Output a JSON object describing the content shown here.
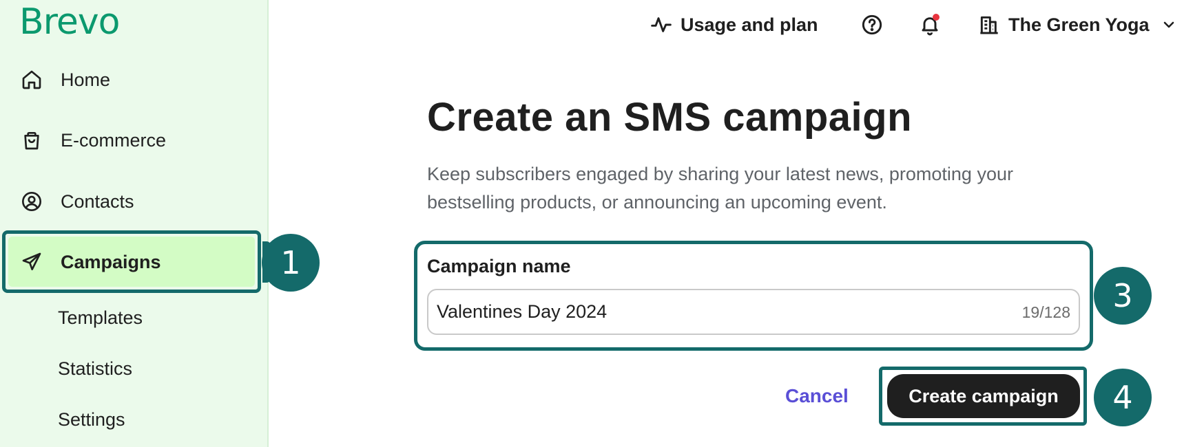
{
  "logo": "Brevo",
  "sidebar": {
    "items": [
      {
        "label": "Home",
        "icon": "home-icon"
      },
      {
        "label": "E-commerce",
        "icon": "shopping-bag-icon"
      },
      {
        "label": "Contacts",
        "icon": "contact-circle-icon"
      },
      {
        "label": "Campaigns",
        "icon": "send-icon",
        "active": true
      }
    ],
    "sub_items": [
      {
        "label": "Templates"
      },
      {
        "label": "Statistics"
      },
      {
        "label": "Settings"
      }
    ]
  },
  "topbar": {
    "usage_label": "Usage and plan",
    "account_name": "The Green Yoga",
    "icons": [
      "activity-icon",
      "help-icon",
      "bell-icon",
      "building-icon",
      "chevron-down-icon"
    ]
  },
  "main": {
    "title": "Create an SMS campaign",
    "description": "Keep subscribers engaged by sharing your latest news, promoting your bestselling products, or announcing an upcoming event.",
    "field": {
      "label": "Campaign name",
      "value": "Valentines Day 2024",
      "counter": "19/128"
    },
    "cancel_label": "Cancel",
    "create_label": "Create campaign"
  },
  "annotations": {
    "step_campaigns": "1",
    "step_field": "3",
    "step_create": "4"
  },
  "colors": {
    "brand_green": "#0b996e",
    "sidebar_bg": "#ebfaeb",
    "active_bg": "#d3fcc5",
    "highlight_teal": "#146a6a",
    "link_purple": "#5a4fd6",
    "button_dark": "#1f1f1f"
  }
}
